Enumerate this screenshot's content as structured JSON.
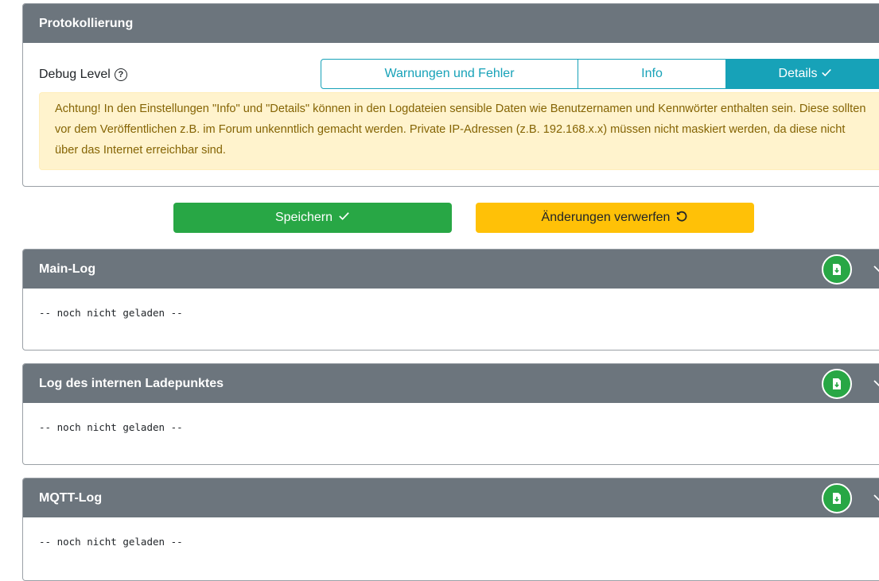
{
  "protokollierung": {
    "title": "Protokollierung",
    "debug_label": "Debug Level",
    "levels": [
      "Warnungen und Fehler",
      "Info",
      "Details"
    ],
    "selected_level": "Details",
    "alert_text": "Achtung! In den Einstellungen \"Info\" und \"Details\" können in den Logdateien sensible Daten wie Benutzernamen und Kennwörter enthalten sein. Diese sollten vor dem Veröffentlichen z.B. im Forum unkenntlich gemacht werden. Private IP-Adressen (z.B. 192.168.x.x) müssen nicht maskiert werden, da diese nicht über das Internet erreichbar sind."
  },
  "actions": {
    "save_label": "Speichern",
    "discard_label": "Änderungen verwerfen"
  },
  "logs": [
    {
      "title": "Main-Log",
      "content": "-- noch nicht geladen --"
    },
    {
      "title": "Log des internen Ladepunktes",
      "content": "-- noch nicht geladen --"
    },
    {
      "title": "MQTT-Log",
      "content": "-- noch nicht geladen --"
    }
  ],
  "icons": {
    "help": "question-circle-icon",
    "check": "check-icon",
    "undo": "undo-icon",
    "download": "file-download-icon",
    "collapse": "chevron-down-icon"
  },
  "colors": {
    "header": "#6c757d",
    "info": "#17a2b8",
    "success": "#28a745",
    "warning": "#ffc107",
    "alert_bg": "#fff3cd",
    "alert_text": "#856404"
  }
}
